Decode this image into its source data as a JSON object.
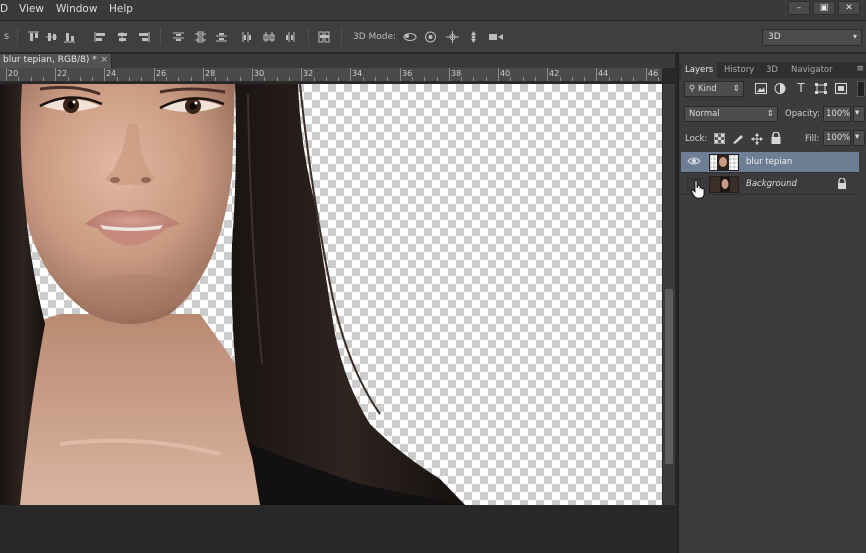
{
  "menubar": {
    "items": [
      "D",
      "View",
      "Window",
      "Help"
    ],
    "window_controls": [
      "–",
      "▣",
      "✕"
    ]
  },
  "options": {
    "mode3d_label": "3D Mode:",
    "dropdown_3d_value": "3D",
    "icons": [
      "align-top-icon",
      "align-vcenter-icon",
      "align-bottom-icon",
      "align-left-icon",
      "align-hcenter-icon",
      "align-right-icon",
      "distribute-top-icon",
      "distribute-vcenter-icon",
      "distribute-bottom-icon",
      "distribute-left-icon",
      "distribute-hcenter-icon",
      "distribute-right-icon",
      "auto-align-icon",
      "rotate-3d-icon",
      "roll-3d-icon",
      "drag-3d-icon",
      "slide-3d-icon",
      "scale-3d-icon"
    ]
  },
  "document": {
    "tab_label": "blur tepian, RGB/8) *",
    "close_glyph": "×",
    "ruler_numbers": [
      "20",
      "22",
      "24",
      "26",
      "28",
      "30",
      "32",
      "34",
      "36",
      "38",
      "40",
      "42",
      "44",
      "46"
    ]
  },
  "panel": {
    "tabs": [
      "Layers",
      "History",
      "3D",
      "Navigator"
    ],
    "menu_glyph": "≡",
    "kind_label": "Kind",
    "blend_mode": "Normal",
    "opacity_label": "Opacity:",
    "opacity_value": "100%",
    "lock_label": "Lock:",
    "fill_label": "Fill:",
    "fill_value": "100%",
    "layers": [
      {
        "name": "blur tepian",
        "visible": true,
        "selected": true,
        "locked": false
      },
      {
        "name": "Background",
        "visible": false,
        "selected": false,
        "locked": true
      }
    ]
  },
  "colors": {
    "accent_selected_layer": "#6d7e95",
    "ui_dark": "#282828",
    "panel_bg": "#3c3c3c"
  }
}
